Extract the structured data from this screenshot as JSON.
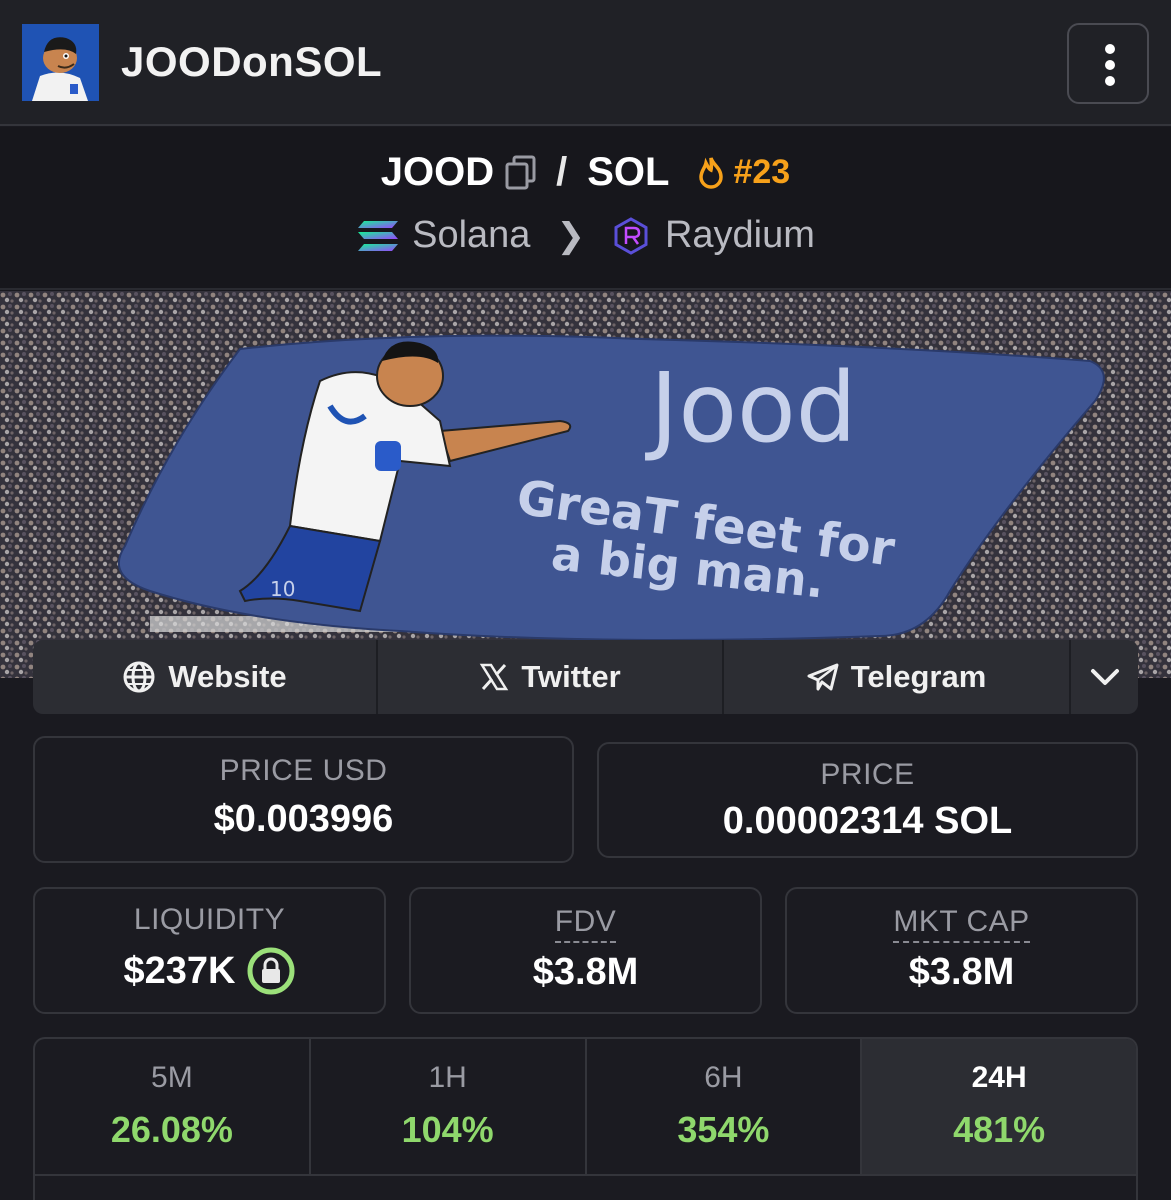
{
  "header": {
    "app_title": "JOODonSOL",
    "menu_icon": "more-vertical-icon"
  },
  "pair": {
    "base": "JOOD",
    "quote": "SOL",
    "separator": "/",
    "rank": "#23",
    "rank_color": "#f7a11a",
    "chain": "Solana",
    "dex": "Raydium"
  },
  "banner": {
    "line1": "Jood",
    "line2": "GreaT feet for",
    "line3": "a big man."
  },
  "links": [
    {
      "label": "Website",
      "icon": "globe-icon"
    },
    {
      "label": "Twitter",
      "icon": "x-icon"
    },
    {
      "label": "Telegram",
      "icon": "telegram-icon"
    }
  ],
  "stats": {
    "price_usd": {
      "label": "PRICE USD",
      "value": "$0.003996"
    },
    "price": {
      "label": "PRICE",
      "value": "0.00002314 SOL"
    },
    "liquidity": {
      "label": "LIQUIDITY",
      "value": "$237K"
    },
    "fdv": {
      "label": "FDV",
      "value": "$3.8M"
    },
    "mkt_cap": {
      "label": "MKT CAP",
      "value": "$3.8M"
    }
  },
  "changes": [
    {
      "label": "5M",
      "value": "26.08%"
    },
    {
      "label": "1H",
      "value": "104%"
    },
    {
      "label": "6H",
      "value": "354%"
    },
    {
      "label": "24H",
      "value": "481%"
    }
  ],
  "colors": {
    "positive": "#8fd86c",
    "lock": "#9be07a",
    "background": "#1a1a20"
  }
}
